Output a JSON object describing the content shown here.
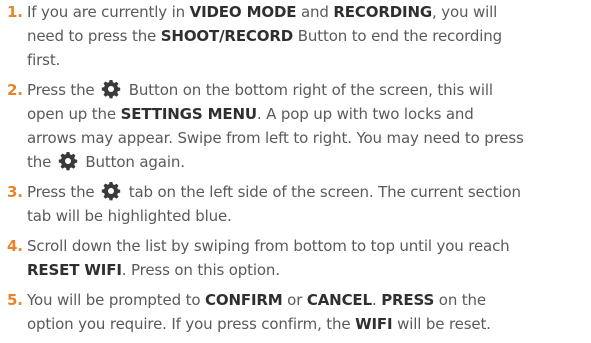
{
  "steps": [
    {
      "number": "1.",
      "l1a": "If you are currently in ",
      "l1b": "VIDEO MODE",
      "l1c": " and ",
      "l1d": "RECORDING",
      "l1e": ", you will",
      "l2a": "need to press the ",
      "l2b": "SHOOT/RECORD",
      "l2c": " Button to end the recording",
      "l3a": "first."
    },
    {
      "number": "2.",
      "l1a": "Press the ",
      "l1b": " Button on the bottom right of the screen, this will",
      "l2a": "open up the ",
      "l2b": "SETTINGS MENU",
      "l2c": ". A pop up with two locks and",
      "l3a": "arrows may appear. Swipe from left to right. You may need to press",
      "l4a": "the ",
      "l4b": " Button again."
    },
    {
      "number": "3.",
      "l1a": "Press the ",
      "l1b": " tab on the left side of the screen. The current section",
      "l2a": "tab will be highlighted blue."
    },
    {
      "number": "4.",
      "l1a": "Scroll down the list by swiping from bottom to top until you reach",
      "l2a": "RESET WIFI",
      "l2b": ". Press on this option."
    },
    {
      "number": "5.",
      "l1a": "You will be prompted to ",
      "l1b": "CONFIRM",
      "l1c": " or ",
      "l1d": "CANCEL",
      "l1e": ". ",
      "l1f": "PRESS",
      "l1g": " on the",
      "l2a": "option you require. If you press confirm, the ",
      "l2b": "WIFI",
      "l2c": " will be reset."
    }
  ],
  "icons": {
    "settings": "gear-icon"
  },
  "colors": {
    "number": "#e8842a",
    "text": "#5a5a5a",
    "bold": "#2f2f2f"
  }
}
